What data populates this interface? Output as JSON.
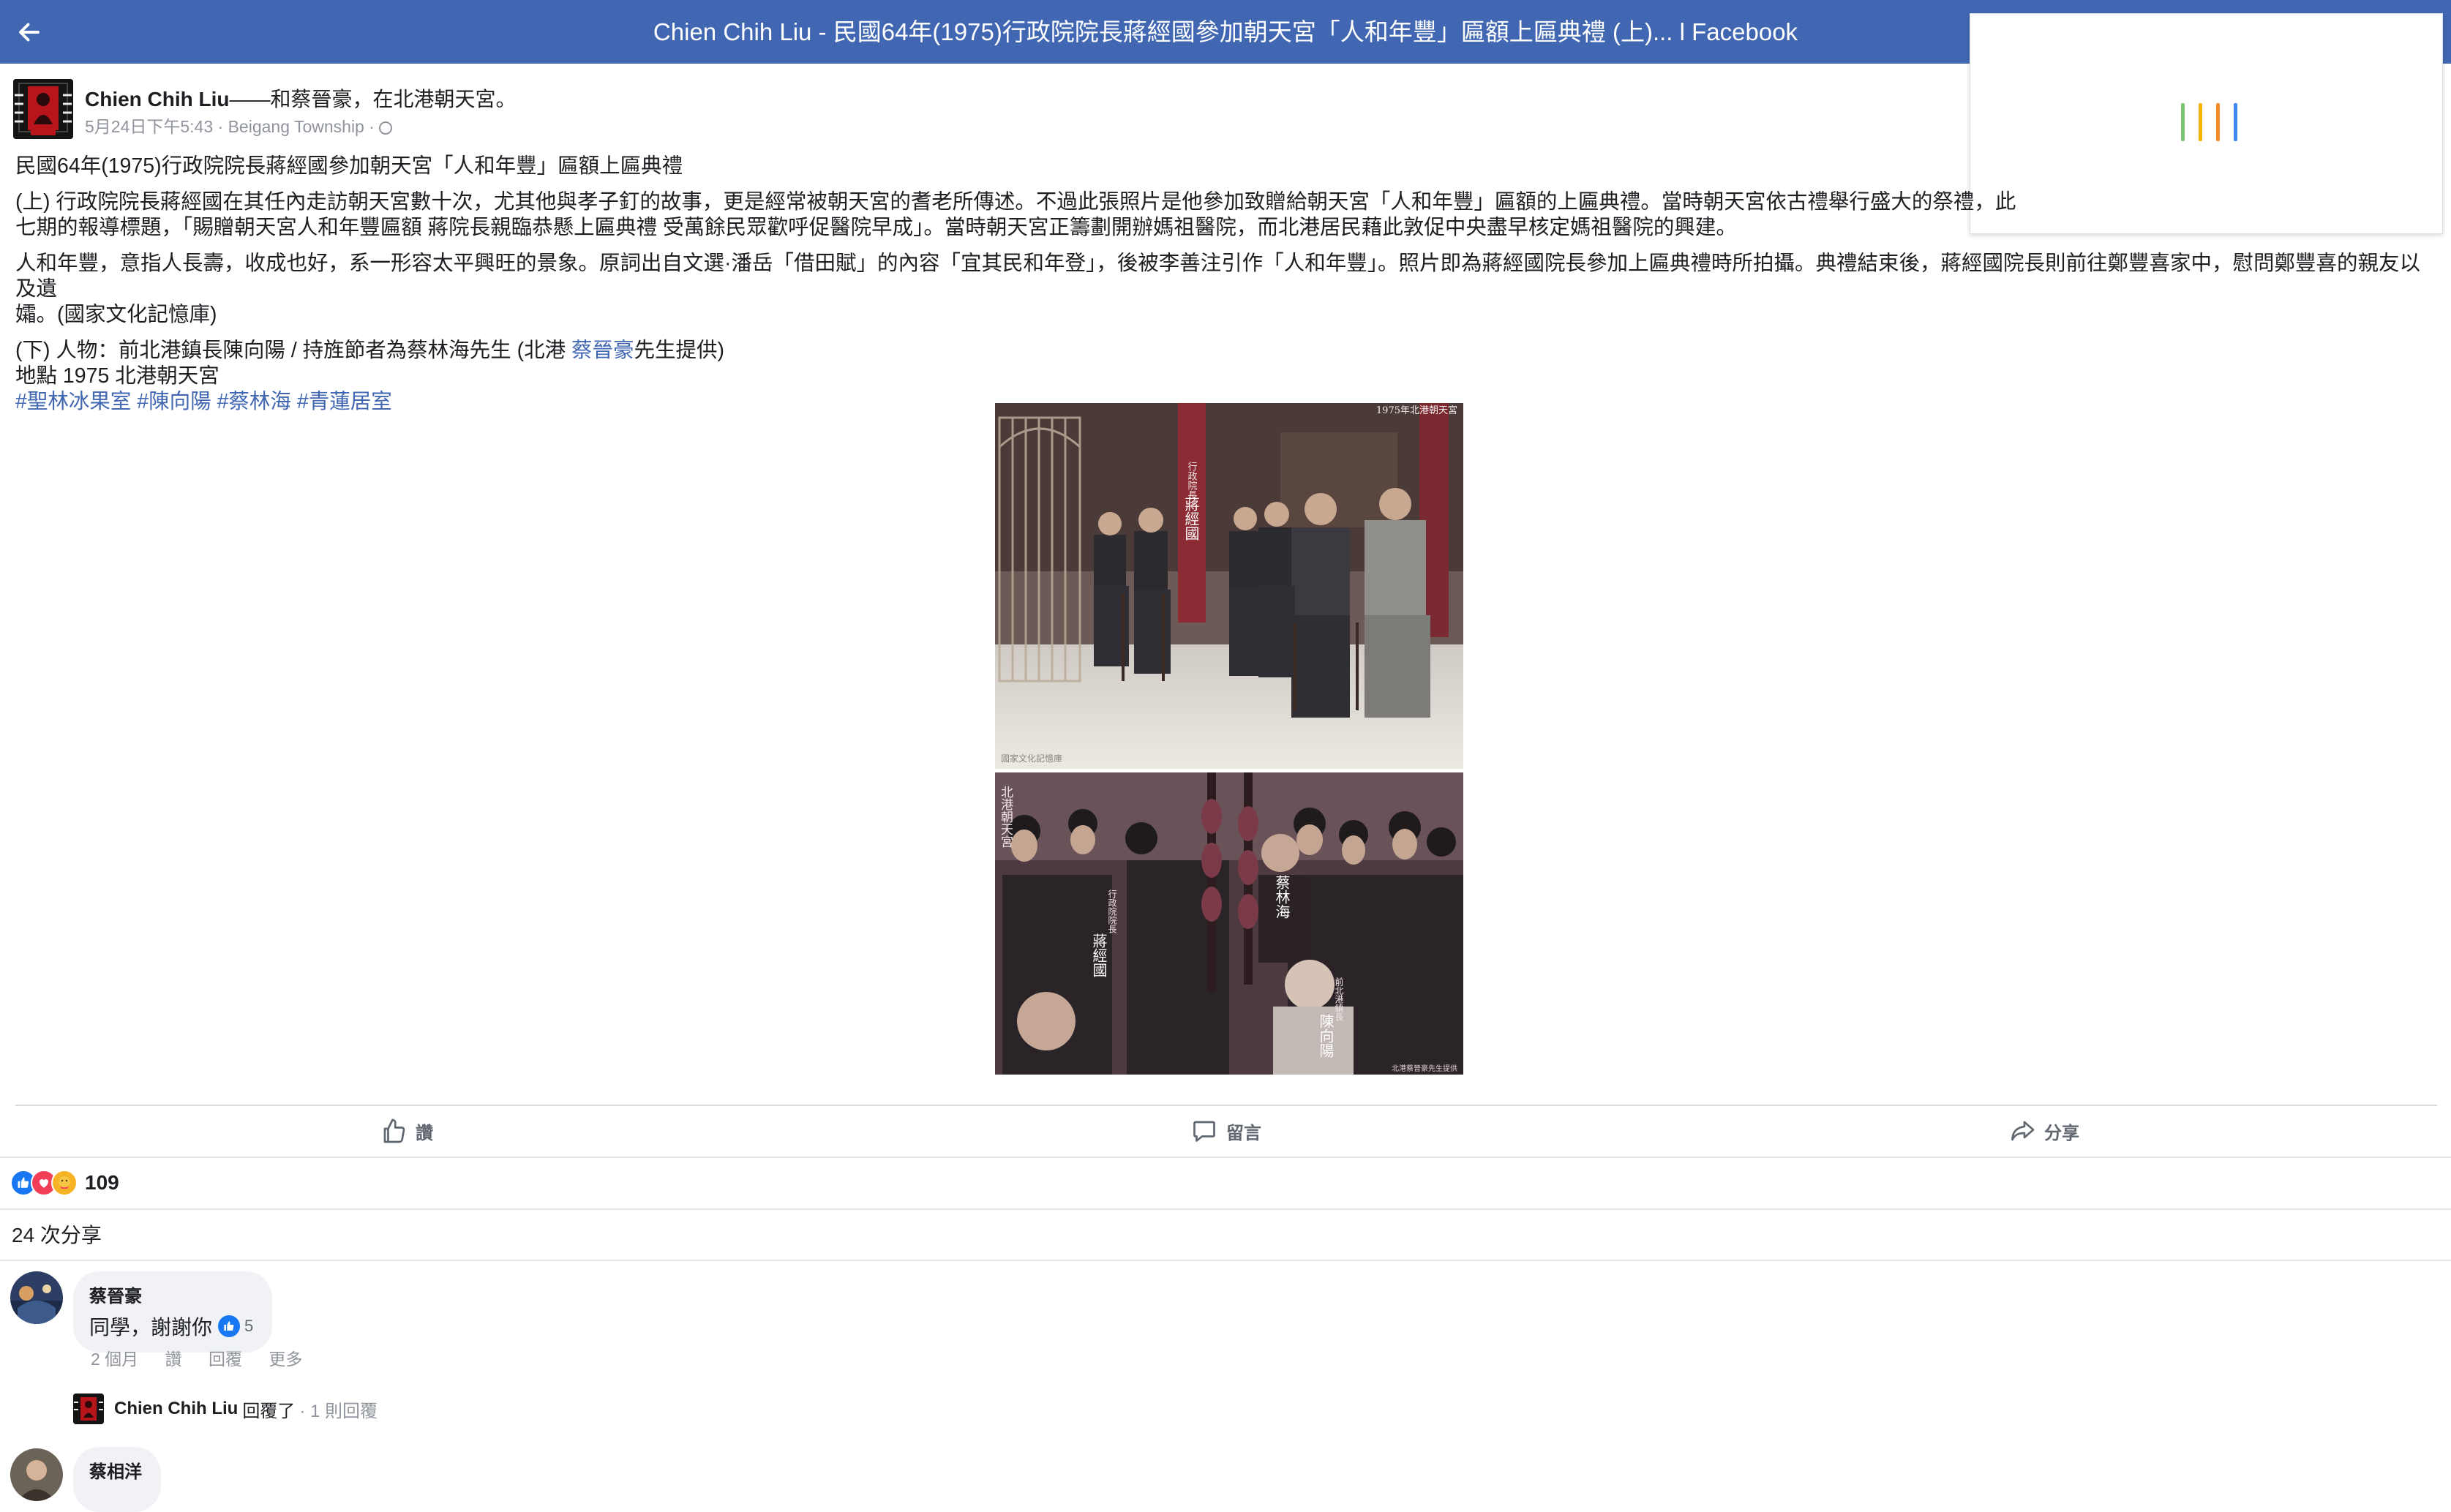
{
  "topbar": {
    "title": "Chien Chih Liu - 民國64年(1975)行政院院長蔣經國參加朝天宮「人和年豐」匾額上匾典禮 (上)... l Facebook",
    "back_icon": "arrow-left-icon",
    "background": "#4267b2"
  },
  "post": {
    "author_name": "Chien Chih Liu",
    "author_suffix": "——和蔡晉豪，在北港朝天宮。",
    "meta": "5月24日下午5:43 · Beigang Township ·",
    "paragraphs": [
      "民國64年(1975)行政院院長蔣經國參加朝天宮「人和年豐」匾額上匾典禮",
      "(上) 行政院院長蔣經國在其任內走訪朝天宮數十次，尤其他與孝子釘的故事，更是經常被朝天宮的耆老所傳述。不過此張照片是他參加致贈給朝天宮「人和年豐」匾額的上匾典禮。當時朝天宮依古禮舉行盛大的祭禮，此",
      "七期的報導標題，「賜贈朝天宮人和年豐匾額 蔣院長親臨恭懸上匾典禮 受萬餘民眾歡呼促醫院早成」。當時朝天宮正籌劃開辦媽祖醫院，而北港居民藉此敦促中央盡早核定媽祖醫院的興建。",
      "人和年豐，意指人長壽，收成也好，系一形容太平興旺的景象。原詞出自文選·潘岳「借田賦」的內容「宜其民和年登」，後被李善注引作「人和年豐」。照片即為蔣經國院長參加上匾典禮時所拍攝。典禮結束後，蔣經國院長則前往鄭豐喜家中，慰問鄭豐喜的親友以及遺",
      "孀。(國家文化記憶庫)"
    ],
    "lower_prefix": "(下) 人物：前北港鎮長陳向陽 / 持旌節者為蔡林海先生 (北港 ",
    "lower_mention": "蔡晉豪",
    "lower_suffix": "先生提供)",
    "location_line": "地點 1975 北港朝天宮",
    "hashtags": [
      "#聖林冰果室",
      "#陳向陽",
      "#蔡林海",
      "#青蓮居室"
    ]
  },
  "photo": {
    "top_caption_corner": "1975年北港朝天宮",
    "top_vertical_label": "蔣經國",
    "top_vertical_label_small": "行政院長",
    "top_bottom_credit": "國家文化記憶庫",
    "bottom_vertical_left": "北港朝天宮",
    "bottom_label_1_small": "行政院院長",
    "bottom_label_1": "蔣經國",
    "bottom_label_2": "蔡林海",
    "bottom_label_3_small": "前北港鎮長",
    "bottom_label_3": "陳向陽",
    "bottom_credit": "北港蔡晉豪先生提供"
  },
  "actions": {
    "like": "讚",
    "comment": "留言",
    "share": "分享"
  },
  "reactions": {
    "count": "109",
    "icons": [
      "like-icon",
      "love-icon",
      "care-icon"
    ]
  },
  "shares": "24 次分享",
  "comments": [
    {
      "name": "蔡晉豪",
      "text": "同學，謝謝你",
      "likes": "5",
      "actions": [
        "2 個月",
        "讚",
        "回覆",
        "更多"
      ]
    },
    {
      "name": "蔡相洋"
    }
  ],
  "reply": {
    "name": "Chien Chih Liu",
    "verb": "回覆了",
    "count": "· 1 則回覆"
  },
  "colors": {
    "accent": "#4267b2",
    "link": "#4267b2",
    "meta": "#90949c",
    "bubble": "#f0f2f5"
  }
}
